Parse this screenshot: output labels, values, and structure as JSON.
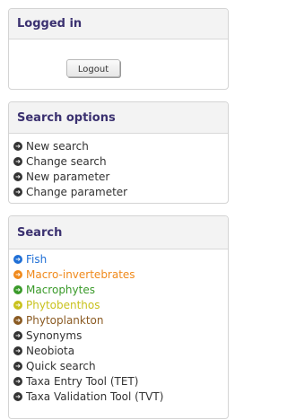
{
  "login_panel": {
    "title": "Logged in",
    "logout_label": "Logout"
  },
  "search_options": {
    "title": "Search options",
    "items": [
      {
        "label": "New search",
        "icon": "arrow-circle-right-icon",
        "color": "#333333"
      },
      {
        "label": "Change search",
        "icon": "arrow-circle-right-icon",
        "color": "#333333"
      },
      {
        "label": "New parameter",
        "icon": "arrow-circle-right-icon",
        "color": "#333333"
      },
      {
        "label": "Change parameter",
        "icon": "arrow-circle-right-icon",
        "color": "#333333"
      }
    ]
  },
  "search": {
    "title": "Search",
    "items": [
      {
        "label": "Fish",
        "icon": "arrow-circle-right-icon",
        "color": "#1f6fd6"
      },
      {
        "label": "Macro-invertebrates",
        "icon": "arrow-circle-right-icon",
        "color": "#f08a1c"
      },
      {
        "label": "Macrophytes",
        "icon": "arrow-circle-right-icon",
        "color": "#3a9a2a"
      },
      {
        "label": "Phytobenthos",
        "icon": "arrow-circle-right-icon",
        "color": "#c9c21d"
      },
      {
        "label": "Phytoplankton",
        "icon": "arrow-circle-right-icon",
        "color": "#8a5a22"
      },
      {
        "label": "Synonyms",
        "icon": "arrow-circle-right-icon",
        "color": "#333333"
      },
      {
        "label": "Neobiota",
        "icon": "arrow-circle-right-icon",
        "color": "#333333"
      },
      {
        "label": "Quick search",
        "icon": "arrow-circle-right-icon",
        "color": "#333333"
      },
      {
        "label": "Taxa Entry Tool (TET)",
        "icon": "arrow-circle-right-icon",
        "color": "#333333"
      },
      {
        "label": "Taxa Validation Tool (TVT)",
        "icon": "arrow-circle-right-icon",
        "color": "#333333"
      }
    ]
  },
  "colors": {
    "header_text": "#3b3170",
    "header_bg": "#f3f3f3",
    "border": "#d4d4d4"
  }
}
